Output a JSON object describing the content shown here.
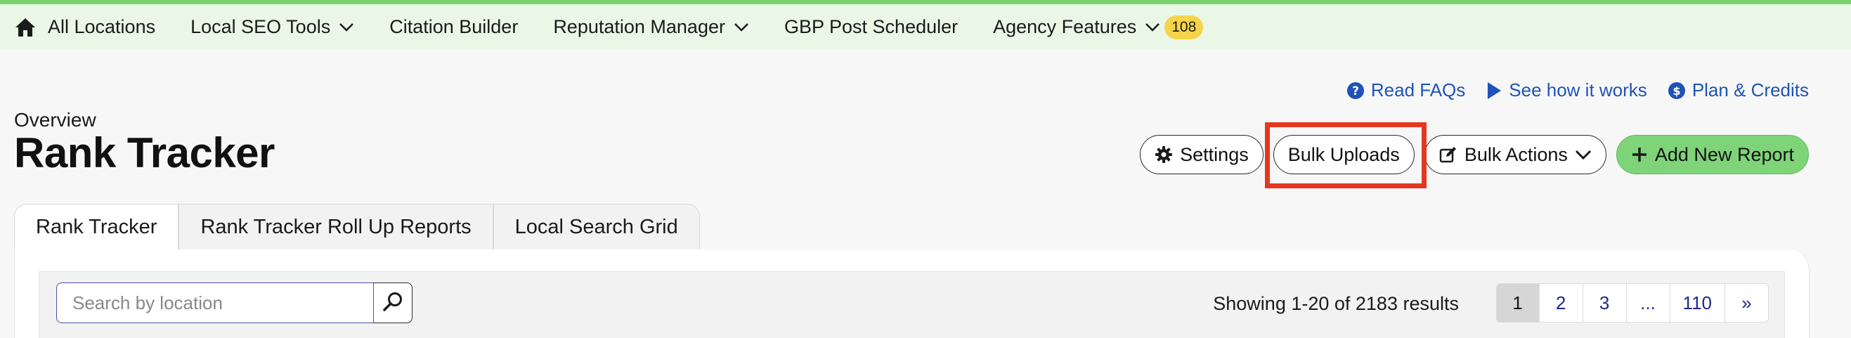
{
  "nav": {
    "home_label": "All Locations",
    "items": [
      {
        "label": "Local SEO Tools",
        "has_dropdown": true
      },
      {
        "label": "Citation Builder",
        "has_dropdown": false
      },
      {
        "label": "Reputation Manager",
        "has_dropdown": true
      },
      {
        "label": "GBP Post Scheduler",
        "has_dropdown": false
      },
      {
        "label": "Agency Features",
        "has_dropdown": true
      }
    ],
    "badge": "108"
  },
  "help_links": [
    {
      "label": "Read FAQs",
      "icon": "question-circle-icon"
    },
    {
      "label": "See how it works",
      "icon": "play-icon"
    },
    {
      "label": "Plan & Credits",
      "icon": "dollar-circle-icon"
    }
  ],
  "header": {
    "eyebrow": "Overview",
    "title": "Rank Tracker"
  },
  "actions": {
    "settings": "Settings",
    "bulk_uploads": "Bulk Uploads",
    "bulk_actions": "Bulk Actions",
    "add_new_report": "Add New Report"
  },
  "tabs": [
    {
      "label": "Rank Tracker",
      "active": true
    },
    {
      "label": "Rank Tracker Roll Up Reports",
      "active": false
    },
    {
      "label": "Local Search Grid",
      "active": false
    }
  ],
  "search": {
    "placeholder": "Search by location",
    "value": ""
  },
  "results_text": "Showing 1-20 of 2183 results",
  "pagination": {
    "pages": [
      "1",
      "2",
      "3",
      "...",
      "110"
    ],
    "current": "1",
    "next": "»"
  },
  "colors": {
    "nav_bg": "#eaf7e6",
    "nav_accent": "#7ad26e",
    "link": "#1f53b8",
    "primary_button": "#7fd47a",
    "highlight": "#e6361f",
    "badge": "#f6d44a"
  }
}
